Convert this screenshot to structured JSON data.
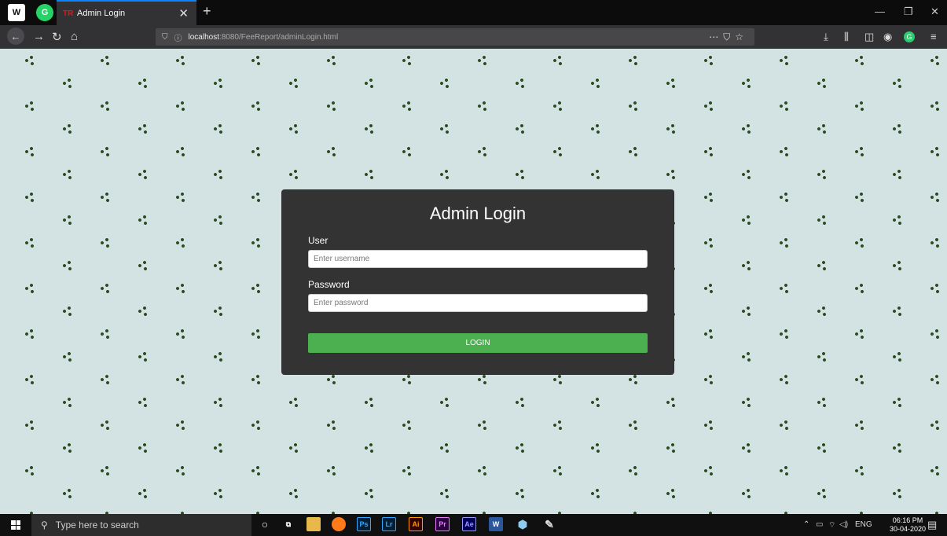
{
  "browser": {
    "tab_title": "Admin Login",
    "tab_favicon": "TR",
    "url_host": "localhost",
    "url_rest": ":8080/FeeReport/adminLogin.html",
    "pinned_w": "W",
    "pinned_g": "G",
    "account_initial": "G"
  },
  "login": {
    "title": "Admin Login",
    "user_label": "User",
    "user_placeholder": "Enter username",
    "password_label": "Password",
    "password_placeholder": "Enter password",
    "button_label": "LOGIN",
    "button_color": "#4caf50",
    "card_color": "#333333"
  },
  "page": {
    "background_color": "#d3e2e2"
  },
  "taskbar": {
    "search_placeholder": "Type here to search",
    "apps": [
      "Ps",
      "Lr",
      "Ai",
      "Pr",
      "Ae",
      "W"
    ],
    "language": "ENG",
    "time": "06:16 PM",
    "date": "30-04-2020"
  }
}
